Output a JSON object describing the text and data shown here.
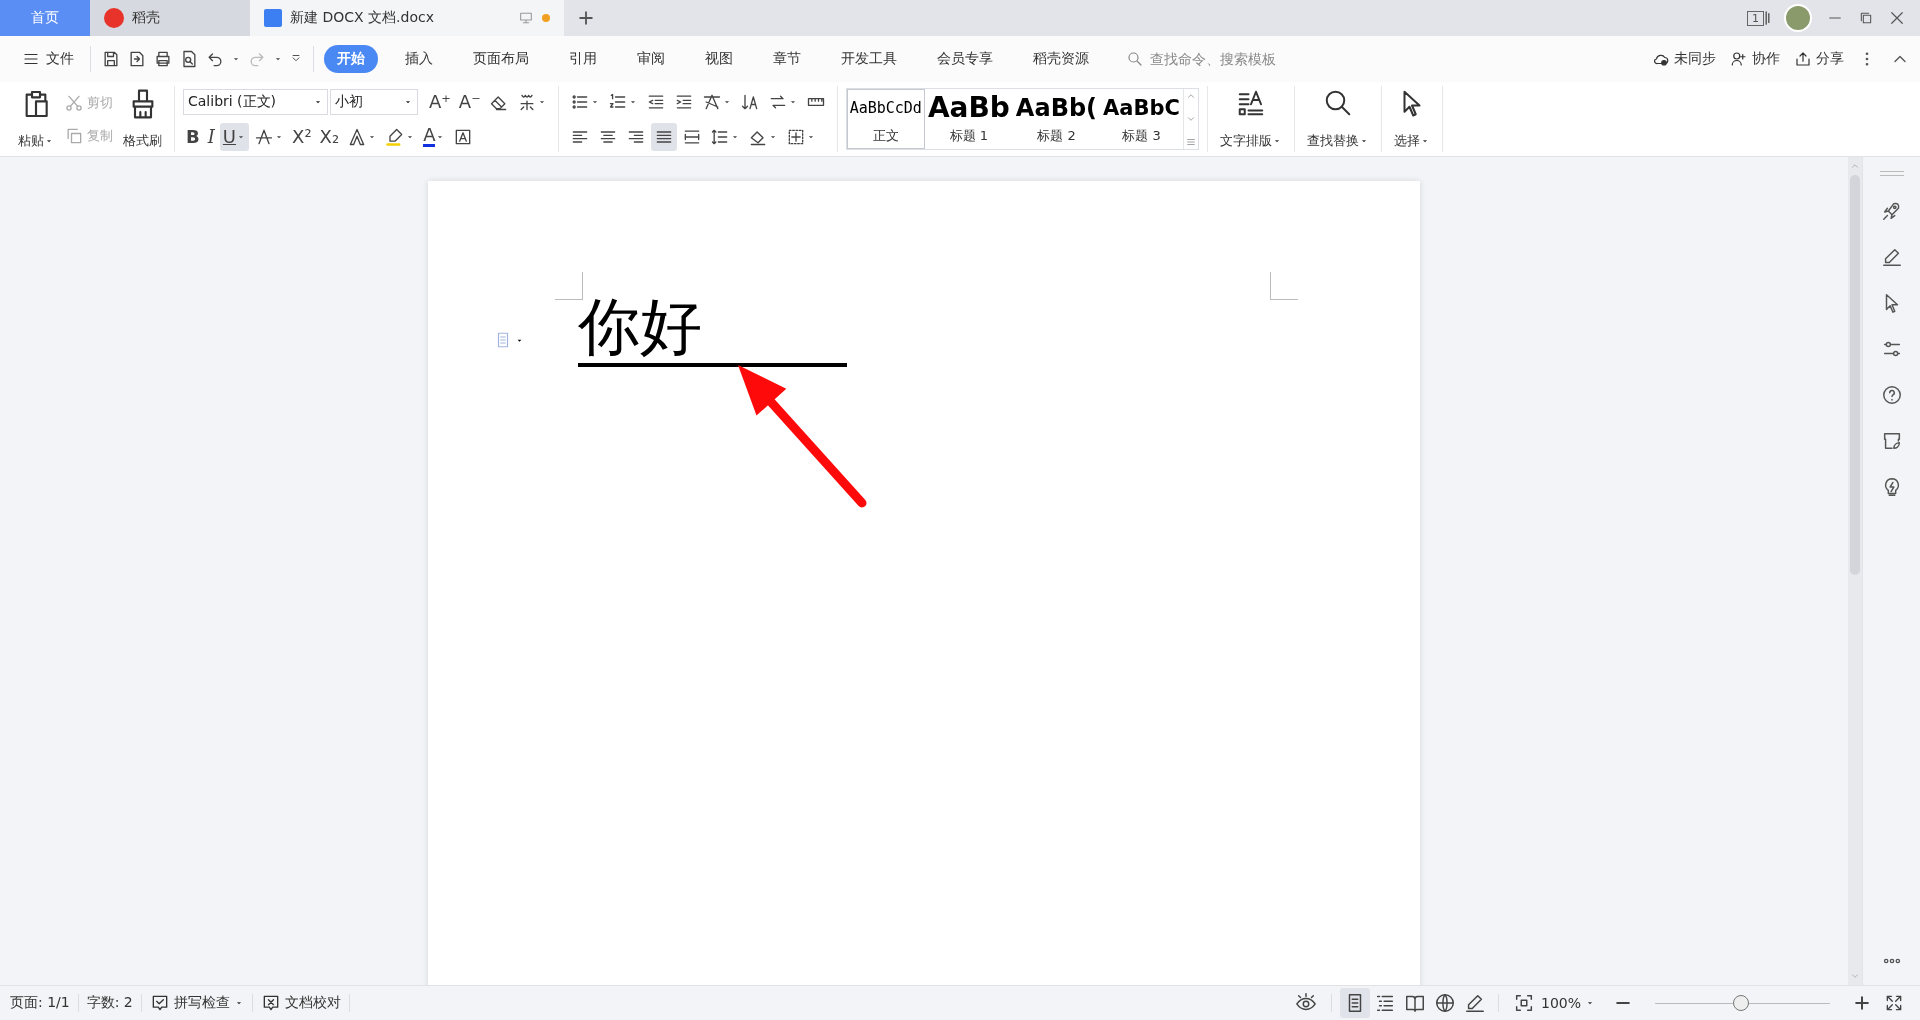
{
  "tabs": [
    {
      "label": "首页",
      "kind": "home",
      "selected": false
    },
    {
      "label": "稻壳",
      "kind": "store",
      "selected": false
    },
    {
      "label": "新建 DOCX 文档.docx",
      "kind": "document",
      "selected": true,
      "unsaved": true
    }
  ],
  "title_bar": {
    "window_count": "1"
  },
  "menu": {
    "file_label": "文件",
    "quick_access": [
      {
        "kind": "save",
        "disabled": false
      },
      {
        "kind": "export",
        "disabled": false
      },
      {
        "kind": "print",
        "disabled": false
      },
      {
        "kind": "preview",
        "disabled": false
      },
      {
        "kind": "undo",
        "disabled": false
      },
      {
        "kind": "redo",
        "disabled": true
      },
      {
        "kind": "customize",
        "disabled": false
      }
    ],
    "tabs": [
      {
        "label": "开始",
        "selected": true
      },
      {
        "label": "插入",
        "selected": false
      },
      {
        "label": "页面布局",
        "selected": false
      },
      {
        "label": "引用",
        "selected": false
      },
      {
        "label": "审阅",
        "selected": false
      },
      {
        "label": "视图",
        "selected": false
      },
      {
        "label": "章节",
        "selected": false
      },
      {
        "label": "开发工具",
        "selected": false
      },
      {
        "label": "会员专享",
        "selected": false
      },
      {
        "label": "稻壳资源",
        "selected": false
      }
    ],
    "search": {
      "placeholder": "查找命令、搜索模板"
    },
    "actions": [
      {
        "label": "未同步",
        "kind": "sync"
      },
      {
        "label": "协作",
        "kind": "collab"
      },
      {
        "label": "分享",
        "kind": "share"
      }
    ]
  },
  "ribbon": {
    "clipboard": [
      {
        "label": "粘贴",
        "kind": "paste",
        "disabled": false,
        "dropdown": true
      },
      {
        "label": "剪切",
        "kind": "cut",
        "disabled": true,
        "dropdown": false
      },
      {
        "label": "复制",
        "kind": "copy",
        "disabled": true,
        "dropdown": false
      },
      {
        "label": "格式刷",
        "kind": "painter",
        "disabled": false,
        "dropdown": false
      }
    ],
    "font": {
      "name": "Calibri (正文)",
      "size": "小初",
      "row1": [
        {
          "kind": "grow",
          "glyph": "A⁺",
          "selected": false,
          "dropdown": false
        },
        {
          "kind": "shrink",
          "glyph": "A⁻",
          "selected": false,
          "dropdown": false
        },
        {
          "kind": "eraser",
          "selected": false,
          "dropdown": false
        },
        {
          "kind": "phonetic",
          "selected": false,
          "dropdown": true
        }
      ],
      "row2": [
        {
          "kind": "bold",
          "glyph": "B",
          "selected": false,
          "dropdown": false
        },
        {
          "kind": "italic",
          "glyph": "I",
          "selected": false,
          "dropdown": false
        },
        {
          "kind": "underline",
          "glyph": "U",
          "selected": true,
          "dropdown": true
        },
        {
          "kind": "strike",
          "selected": false,
          "dropdown": true
        },
        {
          "kind": "superscript",
          "glyph": "X²",
          "selected": false,
          "dropdown": false
        },
        {
          "kind": "subscript",
          "glyph": "X₂",
          "selected": false,
          "dropdown": false
        },
        {
          "kind": "effect",
          "selected": false,
          "dropdown": true
        },
        {
          "kind": "highlight",
          "selected": false,
          "dropdown": true
        },
        {
          "kind": "color",
          "glyph": "A",
          "selected": false,
          "dropdown": true
        },
        {
          "kind": "charborder",
          "selected": false,
          "dropdown": false
        }
      ]
    },
    "paragraph": {
      "row1": [
        {
          "kind": "bullets",
          "selected": false,
          "dropdown": true
        },
        {
          "kind": "numbering",
          "selected": false,
          "dropdown": true
        },
        {
          "kind": "outdent",
          "selected": false,
          "dropdown": false
        },
        {
          "kind": "indent",
          "selected": false,
          "dropdown": false
        },
        {
          "kind": "cnlayout",
          "selected": false,
          "dropdown": true
        },
        {
          "kind": "sort",
          "selected": false,
          "dropdown": false
        },
        {
          "kind": "direction",
          "selected": false,
          "dropdown": true
        },
        {
          "kind": "tabstops",
          "selected": false,
          "dropdown": false
        }
      ],
      "row2": [
        {
          "kind": "left",
          "selected": false,
          "dropdown": false
        },
        {
          "kind": "center",
          "selected": false,
          "dropdown": false
        },
        {
          "kind": "right",
          "selected": false,
          "dropdown": false
        },
        {
          "kind": "justify",
          "selected": true,
          "dropdown": false
        },
        {
          "kind": "distributed",
          "selected": false,
          "dropdown": false
        },
        {
          "kind": "linespacing",
          "selected": false,
          "dropdown": true
        },
        {
          "kind": "shading",
          "selected": false,
          "dropdown": true
        },
        {
          "kind": "borders",
          "selected": false,
          "dropdown": true
        }
      ]
    },
    "styles": [
      {
        "preview": "AaBbCcDd",
        "label": "正文",
        "kind": "body",
        "selected": true
      },
      {
        "preview": "AaBb",
        "label": "标题 1",
        "kind": "heading1",
        "selected": false
      },
      {
        "preview": "AaBb(",
        "label": "标题 2",
        "kind": "heading2",
        "selected": false
      },
      {
        "preview": "AaBbC",
        "label": "标题 3",
        "kind": "heading3",
        "selected": false
      }
    ],
    "tools": [
      {
        "label": "文字排版",
        "kind": "layout",
        "dropdown": true
      },
      {
        "label": "查找替换",
        "kind": "find",
        "dropdown": true
      },
      {
        "label": "选择",
        "kind": "select",
        "dropdown": true
      }
    ]
  },
  "document": {
    "paragraphs": [
      {
        "text": "你好",
        "underline": true
      }
    ]
  },
  "status": {
    "page": "页面: 1/1",
    "words": "字数: 2",
    "spell": "拼写检查",
    "proof": "文档校对",
    "views": [
      {
        "kind": "page",
        "selected": true
      },
      {
        "kind": "outline",
        "selected": false
      },
      {
        "kind": "read",
        "selected": false
      },
      {
        "kind": "web",
        "selected": false
      },
      {
        "kind": "write",
        "selected": false
      }
    ],
    "zoom": "100%",
    "zoom_slider": {
      "level": 0.49
    }
  }
}
